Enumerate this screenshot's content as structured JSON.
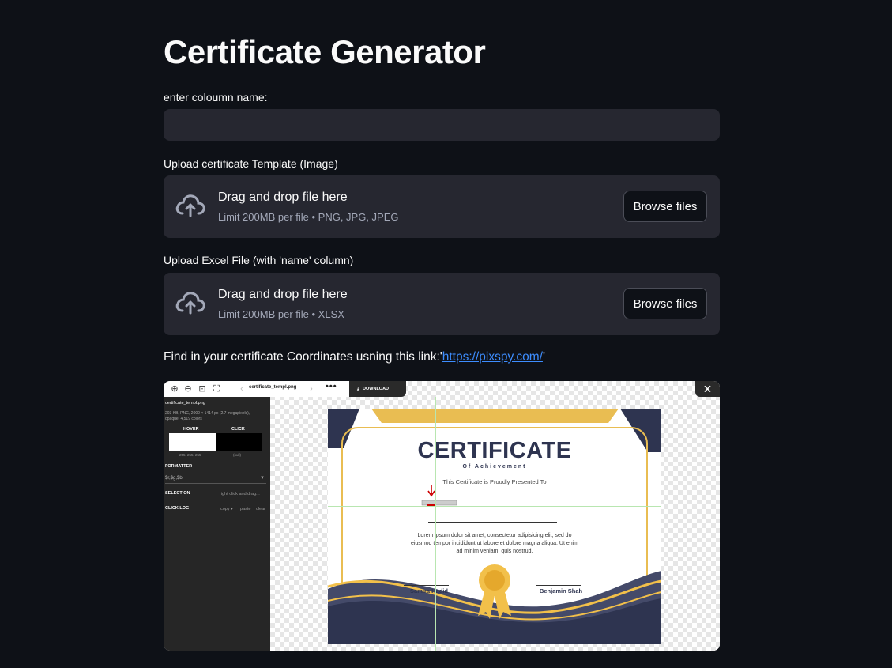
{
  "page": {
    "title": "Certificate Generator",
    "column_label": "enter coloumn name:",
    "column_value": "",
    "template_upload": {
      "label": "Upload certificate Template (Image)",
      "drop_text": "Drag and drop file here",
      "limit_text": "Limit 200MB per file • PNG, JPG, JPEG",
      "button": "Browse files"
    },
    "excel_upload": {
      "label": "Upload Excel File (with 'name' column)",
      "drop_text": "Drag and drop file here",
      "limit_text": "Limit 200MB per file • XLSX",
      "button": "Browse files"
    },
    "link_prefix": "Find in your certificate Coordinates usning this link:'",
    "link_text": "https://pixspy.com/",
    "link_suffix": "'"
  },
  "screenshot": {
    "toolbar_filename": "certificate_templ.png",
    "toolbar_dots": "•••",
    "toolbar_download": "DOWNLOAD",
    "close_icon": "close-icon",
    "panel_filename": "certificate_templ.png",
    "panel_meta_1": "203 KB, PNG, 2000 × 1414 px (2.7 megapixels),",
    "panel_meta_2": "opaque, 4,519 colors",
    "hover_label": "HOVER",
    "click_label": "CLICK",
    "hover_value": "255, 255, 255",
    "click_value": "(null)",
    "formatter_label": "FORMATTER",
    "formatter_value": "$r,$g,$b",
    "selection_label": "SELECTION",
    "selection_hint": "right click and drag...",
    "click_log_label": "CLICK LOG",
    "click_log_copy": "copy ▾",
    "click_log_paste": "paste",
    "click_log_clear": "clear"
  },
  "certificate": {
    "heading": "CERTIFICATE",
    "subheading": "Of Achievement",
    "presented": "This Certificate is Proudly Presented To",
    "body_1": "Lorem ipsum dolor sit amet, consectetur adipisicing elit, sed do",
    "body_2": "eiusmod tempor incididunt ut labore et dolore magna aliqua. Ut enim",
    "body_3": "ad minim veniam, quis nostrud.",
    "signer_left": "Samira Hadid",
    "signer_right": "Benjamin Shah"
  },
  "colors": {
    "background": "#0e1117",
    "input_bg": "#262730",
    "link": "#3d8dff",
    "cert_navy": "#2e3450",
    "cert_gold": "#f2c04a"
  }
}
